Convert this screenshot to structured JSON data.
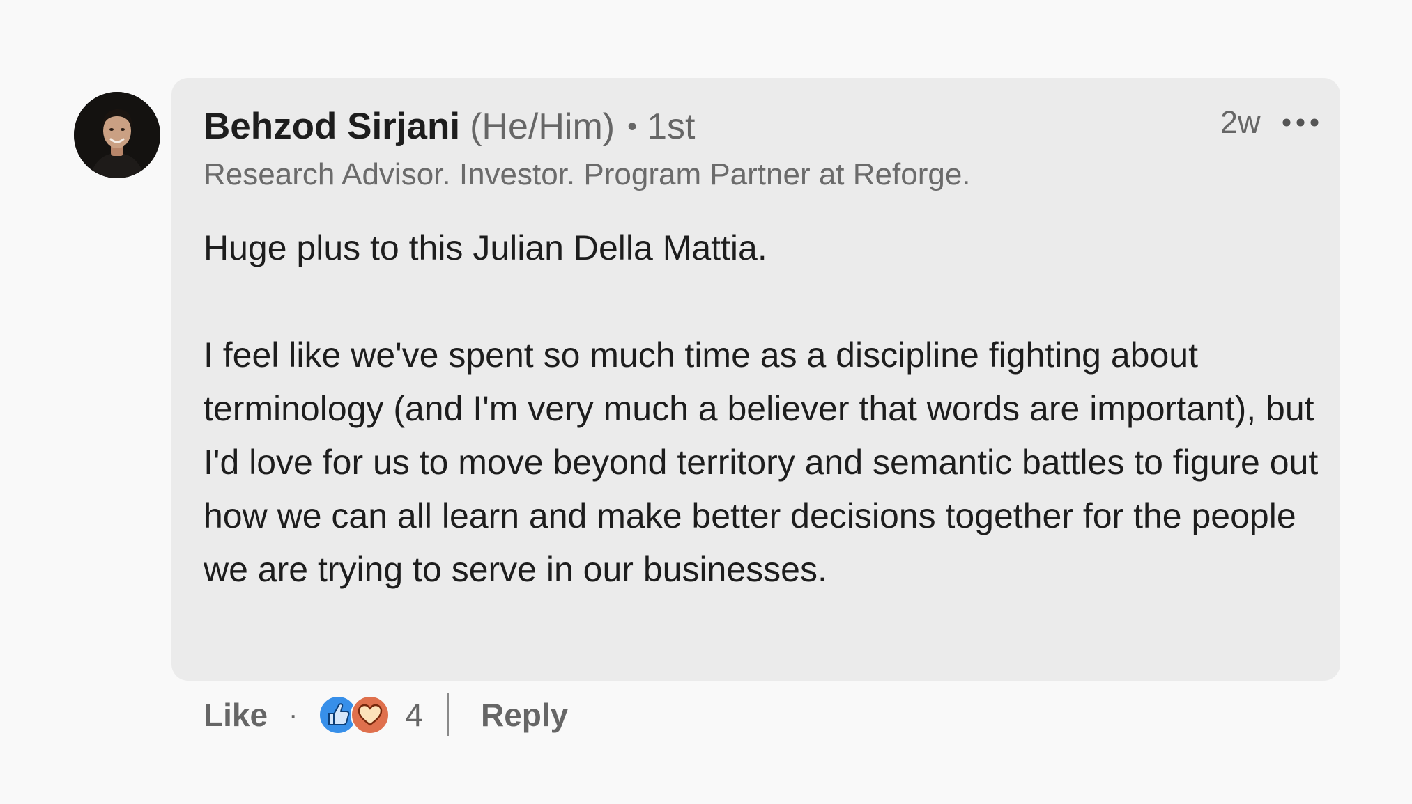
{
  "comment": {
    "author": {
      "name": "Behzod Sirjani",
      "pronouns": "(He/Him)",
      "connection_bullet": "•",
      "connection_degree": "1st",
      "headline": "Research Advisor. Investor. Program Partner at Reforge.",
      "avatar_icon": "profile-photo"
    },
    "timestamp": "2w",
    "more_icon": "ellipsis-horizontal-icon",
    "body": {
      "paragraph_1": "Huge plus to this Julian Della Mattia.",
      "paragraph_2": "I feel like we've spent so much time as a discipline fighting about terminology (and I'm very much a believer that words are important), but I'd love for us to move beyond territory and semantic battles to figure out how we can all learn and make better decisions together for the people we are trying to serve in our businesses."
    }
  },
  "actions": {
    "like_label": "Like",
    "separator": "·",
    "reactions": {
      "icons": [
        "like-reaction-icon",
        "love-reaction-icon"
      ],
      "count": "4"
    },
    "reply_label": "Reply"
  },
  "colors": {
    "background": "#f9f9f9",
    "bubble": "#ebebeb",
    "like_blue": "#378fe9",
    "love_red": "#df704d"
  }
}
